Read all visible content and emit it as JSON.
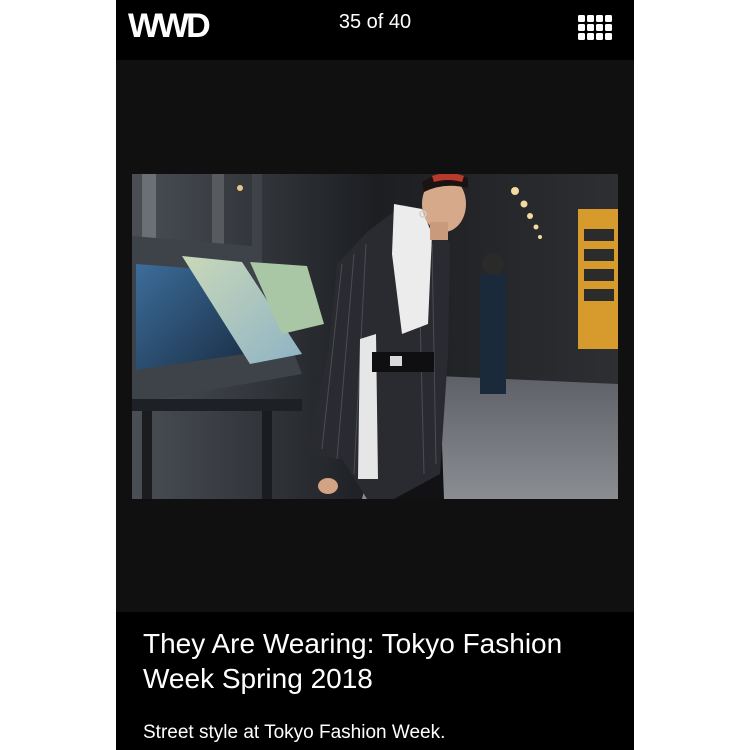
{
  "header": {
    "logo": "WWD",
    "counter": "35 of 40",
    "menu_icon": "grid-icon"
  },
  "slide": {
    "image_alt": "Street style photo",
    "title": "They Are Wearing: Tokyo Fashion Week Spring 2018",
    "caption": "Street style at Tokyo Fashion Week."
  },
  "colors": {
    "background": "#0a0a0a",
    "text": "#ffffff",
    "page": "#ffffff"
  }
}
